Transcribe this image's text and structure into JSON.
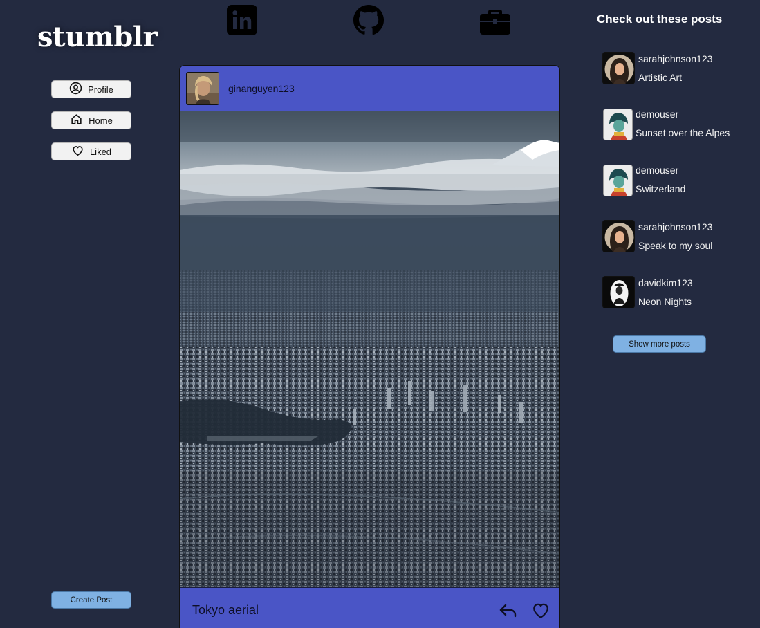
{
  "app": {
    "logo": "stumblr"
  },
  "sidebar": {
    "items": [
      {
        "label": "Profile",
        "icon": "user-circle-icon"
      },
      {
        "label": "Home",
        "icon": "home-icon"
      },
      {
        "label": "Liked",
        "icon": "heart-icon"
      }
    ],
    "create_label": "Create Post"
  },
  "social": [
    {
      "icon": "linkedin-icon"
    },
    {
      "icon": "github-icon"
    },
    {
      "icon": "briefcase-icon"
    }
  ],
  "post": {
    "username": "ginanguyen123",
    "caption": "Tokyo aerial",
    "actions": [
      {
        "icon": "reply-icon"
      },
      {
        "icon": "heart-icon"
      }
    ]
  },
  "right_panel": {
    "title": "Check out these posts",
    "posts": [
      {
        "user": "sarahjohnson123",
        "title": "Artistic Art"
      },
      {
        "user": "demouser",
        "title": "Sunset over the Alpes"
      },
      {
        "user": "demouser",
        "title": "Switzerland"
      },
      {
        "user": "sarahjohnson123",
        "title": "Speak to my soul"
      },
      {
        "user": "davidkim123",
        "title": "Neon Nights"
      }
    ],
    "show_more_label": "Show more posts"
  },
  "colors": {
    "background": "#232a40",
    "card": "#4a55c6",
    "button_light": "#f2f2f2",
    "button_accent": "#7fb1e3"
  }
}
